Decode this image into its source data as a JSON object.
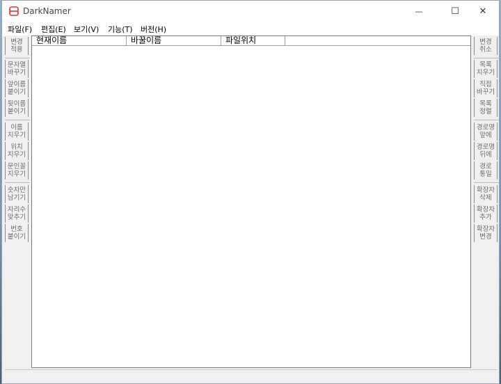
{
  "window": {
    "title": "DarkNamer"
  },
  "colors": {
    "app_icon": "#e0322d"
  },
  "window_controls": {
    "minimize": "—",
    "maximize": "☐",
    "close": "✕"
  },
  "menu": [
    "파일(F)",
    "편집(E)",
    "보기(V)",
    "기능(T)",
    "버전(H)"
  ],
  "left_buttons": [
    "변경\n적용",
    "문자열\n바꾸기",
    "앞이름\n붙이기",
    "뒷이름\n붙이기",
    "이름\n지우기",
    "위치\n지우기",
    "문인꼴\n지우기",
    "숫자만\n남기기",
    "자리수\n맞추기",
    "번호\n붙이기"
  ],
  "right_buttons": [
    "변경\n취소",
    "목록\n지우기",
    "직접\n바꾸기",
    "목록\n정렬",
    "경로명\n앞에",
    "경로명\n뒤에",
    "경로\n통일",
    "확장자\n삭제",
    "확장자\n추가",
    "확장자\n변경"
  ],
  "columns": [
    "현재이름",
    "바꿀이름",
    "파일위치"
  ]
}
